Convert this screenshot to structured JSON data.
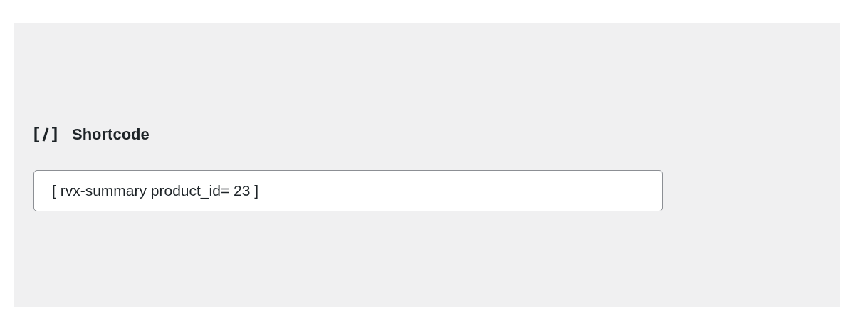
{
  "shortcode": {
    "title": "Shortcode",
    "value": "[ rvx-summary product_id= 23 ]"
  }
}
